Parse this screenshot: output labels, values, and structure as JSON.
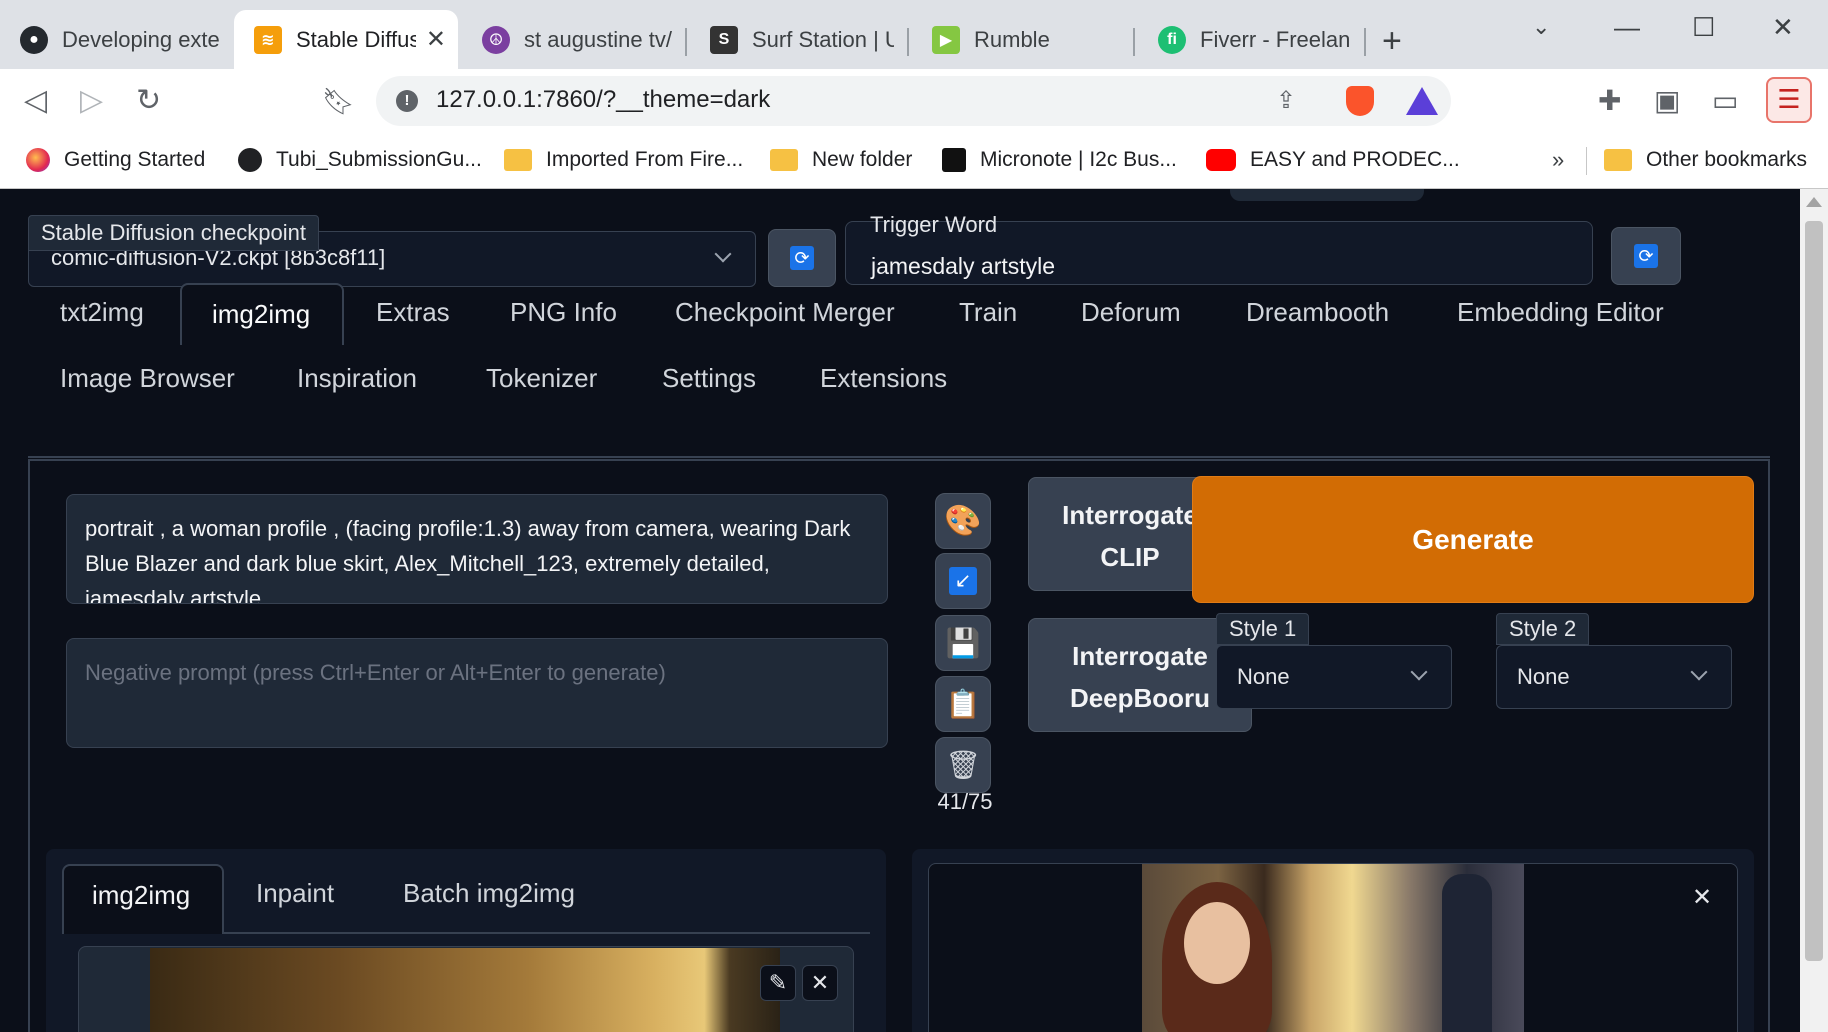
{
  "browser": {
    "tabs": [
      {
        "title": "Developing exten",
        "icon": "github-icon",
        "color": "#24292e"
      },
      {
        "title": "Stable Diffusi",
        "icon": "stable-diffusion-icon",
        "color": "#f59e0b",
        "active": true
      },
      {
        "title": "st augustine tv/fil",
        "icon": "peace-icon",
        "color": "#7b3fa0"
      },
      {
        "title": "Surf Station | Upd",
        "icon": "surf-icon",
        "color": "#333333"
      },
      {
        "title": "Rumble",
        "icon": "rumble-icon",
        "color": "#85c742"
      },
      {
        "title": "Fiverr - Freelance",
        "icon": "fiverr-icon",
        "color": "#1dbf73"
      }
    ],
    "url": "127.0.0.1:7860/?__theme=dark",
    "bookmarks": [
      {
        "label": "Getting Started",
        "icon": "firefox-icon"
      },
      {
        "label": "Tubi_SubmissionGu...",
        "icon": "globe-icon"
      },
      {
        "label": "Imported From Fire...",
        "icon": "folder-icon"
      },
      {
        "label": "New folder",
        "icon": "folder-icon"
      },
      {
        "label": "Micronote | I2c Bus...",
        "icon": "micronote-icon"
      },
      {
        "label": "EASY and PRODEC...",
        "icon": "youtube-icon"
      }
    ],
    "other_bookmarks": "Other bookmarks",
    "bookmarks_overflow": "»"
  },
  "header": {
    "checkpoint_label": "Stable Diffusion checkpoint",
    "checkpoint_value": "comic-diffusion-V2.ckpt [8b3c8f11]",
    "trigger_label": "Trigger Word",
    "trigger_value": "jamesdaly artstyle"
  },
  "main_tabs_row1": [
    "txt2img",
    "img2img",
    "Extras",
    "PNG Info",
    "Checkpoint Merger",
    "Train",
    "Deforum",
    "Dreambooth",
    "Embedding Editor"
  ],
  "main_tabs_row2": [
    "Image Browser",
    "Inspiration",
    "Tokenizer",
    "Settings",
    "Extensions"
  ],
  "active_main_tab": "img2img",
  "prompt": {
    "text": "portrait , a woman profile , (facing profile:1.3) away from camera, wearing Dark Blue Blazer and dark blue skirt,   Alex_Mitchell_123, extremely detailed, jamesdaly artstyle",
    "negative_placeholder": "Negative prompt (press Ctrl+Enter or Alt+Enter to generate)",
    "token_count": "41/75"
  },
  "buttons": {
    "interrogate_clip": "Interrogate CLIP",
    "interrogate_deepbooru": "Interrogate DeepBooru",
    "generate": "Generate"
  },
  "styles": {
    "style1_label": "Style 1",
    "style1_value": "None",
    "style2_label": "Style 2",
    "style2_value": "None"
  },
  "sub_tabs": [
    "img2img",
    "Inpaint",
    "Batch img2img"
  ],
  "active_sub_tab": "img2img",
  "colors": {
    "accent": "#d26c04",
    "background": "#0b0f19",
    "panel": "#1f2937"
  }
}
